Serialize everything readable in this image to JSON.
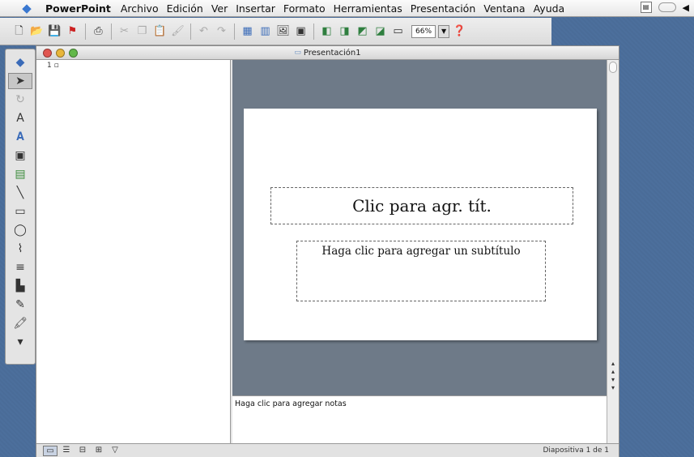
{
  "menubar": {
    "apple": "",
    "app_name": "PowerPoint",
    "items": [
      "Archivo",
      "Edición",
      "Ver",
      "Insertar",
      "Formato",
      "Herramientas",
      "Presentación",
      "Ventana",
      "Ayuda"
    ],
    "extras": {
      "arrow": "◀"
    }
  },
  "toolbar": {
    "zoom": "66%"
  },
  "window": {
    "title": "Presentación1",
    "outline_slide_number": "1"
  },
  "slide": {
    "title_placeholder": "Clic para agr. tít.",
    "subtitle_placeholder": "Haga clic para agregar un subtítulo"
  },
  "notes": {
    "placeholder": "Haga clic para agregar notas"
  },
  "status": {
    "slide_count": "Diapositiva 1 de 1"
  },
  "colors": {
    "desktop": "#4c6f9c",
    "slide_area": "#6e7a88",
    "close": "#e0554f",
    "minimize": "#e8b63a",
    "zoom": "#62b849"
  }
}
